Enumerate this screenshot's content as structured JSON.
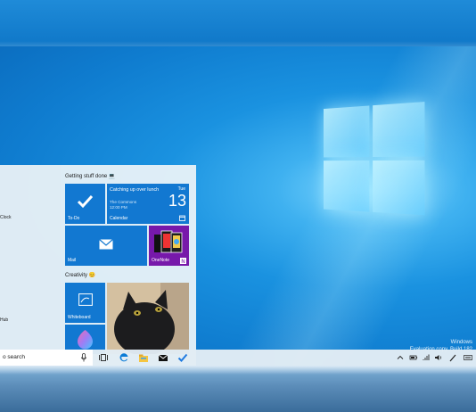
{
  "start_menu": {
    "left_items": [
      "Clock",
      "Hub"
    ],
    "groups": {
      "productivity": "Getting stuff done 💻",
      "creativity": "Creativity 😊"
    },
    "tiles": {
      "todo": "To-Do",
      "calendar": {
        "label": "Calendar",
        "event_title": "Catching up over lunch",
        "event_location": "The Commons",
        "event_time": "12:00 PM",
        "day": "Tue",
        "date": "13"
      },
      "mail": "Mail",
      "onenote": "OneNote",
      "whiteboard": "Whiteboard"
    }
  },
  "taskbar": {
    "search_placeholder": "o search"
  },
  "watermark": {
    "line1": "Windows",
    "line2": "Evaluation copy. Build 182"
  },
  "colors": {
    "tile_blue": "#1278d1",
    "accent": "#0f7ccf"
  }
}
